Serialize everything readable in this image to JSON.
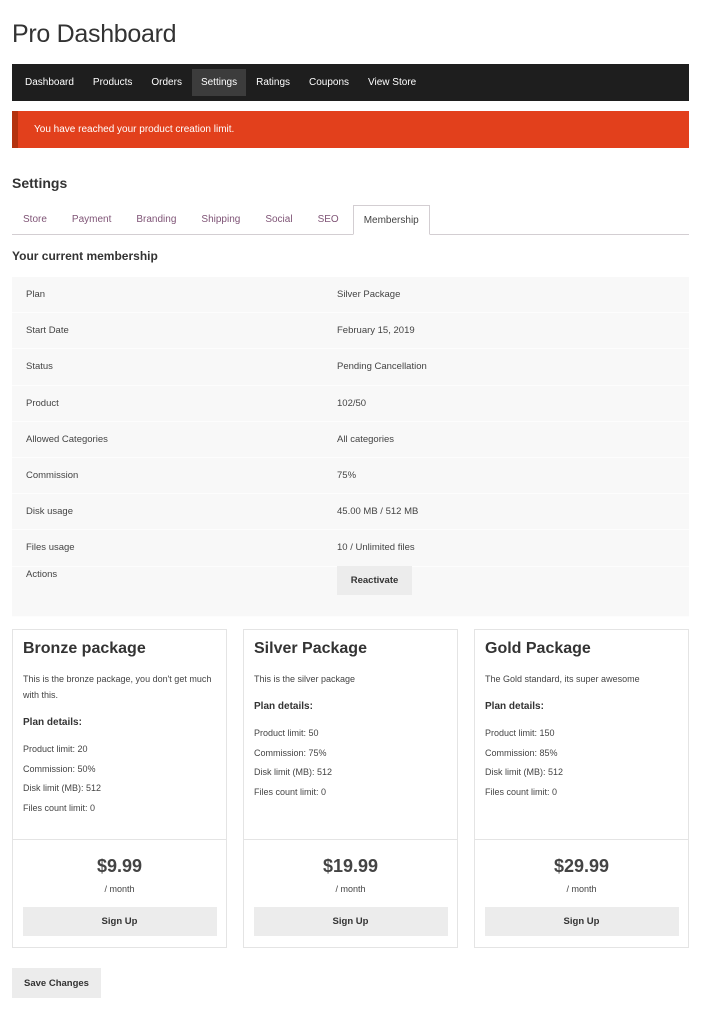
{
  "page": {
    "title": "Pro Dashboard"
  },
  "nav": {
    "items": [
      {
        "label": "Dashboard"
      },
      {
        "label": "Products"
      },
      {
        "label": "Orders"
      },
      {
        "label": "Settings"
      },
      {
        "label": "Ratings"
      },
      {
        "label": "Coupons"
      },
      {
        "label": "View Store"
      }
    ],
    "active": "Settings"
  },
  "alert": {
    "message": "You have reached your product creation limit."
  },
  "settings": {
    "title": "Settings",
    "tabs": [
      {
        "label": "Store"
      },
      {
        "label": "Payment"
      },
      {
        "label": "Branding"
      },
      {
        "label": "Shipping"
      },
      {
        "label": "Social"
      },
      {
        "label": "SEO"
      },
      {
        "label": "Membership"
      }
    ],
    "active_tab": "Membership"
  },
  "membership": {
    "title": "Your current membership",
    "rows": [
      {
        "label": "Plan",
        "value": "Silver Package"
      },
      {
        "label": "Start Date",
        "value": "February 15, 2019"
      },
      {
        "label": "Status",
        "value": "Pending Cancellation"
      },
      {
        "label": "Product",
        "value": "102/50"
      },
      {
        "label": "Allowed Categories",
        "value": "All categories"
      },
      {
        "label": "Commission",
        "value": "75%"
      },
      {
        "label": "Disk usage",
        "value": "45.00 MB / 512 MB"
      },
      {
        "label": "Files usage",
        "value": "10 / Unlimited files"
      }
    ],
    "actions_label": "Actions",
    "reactivate_label": "Reactivate"
  },
  "packages": [
    {
      "name": "Bronze package",
      "description": "This is the bronze package, you don't get much with this.",
      "details_title": "Plan details:",
      "details": [
        "Product limit: 20",
        "Commission: 50%",
        "Disk limit (MB): 512",
        "Files count limit: 0"
      ],
      "price": "$9.99",
      "period": "/ month",
      "button": "Sign Up"
    },
    {
      "name": "Silver Package",
      "description": "This is the silver package",
      "details_title": "Plan details:",
      "details": [
        "Product limit: 50",
        "Commission: 75%",
        "Disk limit (MB): 512",
        "Files count limit: 0"
      ],
      "price": "$19.99",
      "period": "/ month",
      "button": "Sign Up"
    },
    {
      "name": "Gold Package",
      "description": "The Gold standard, its super awesome",
      "details_title": "Plan details:",
      "details": [
        "Product limit: 150",
        "Commission: 85%",
        "Disk limit (MB): 512",
        "Files count limit: 0"
      ],
      "price": "$29.99",
      "period": "/ month",
      "button": "Sign Up"
    }
  ],
  "footer": {
    "save_label": "Save Changes"
  },
  "colors": {
    "navbar_bg": "#1e1e1e",
    "alert_bg": "#e2401c",
    "tab_link": "#7f5476",
    "button_bg": "#ececec",
    "table_bg": "#f8f8f8"
  }
}
